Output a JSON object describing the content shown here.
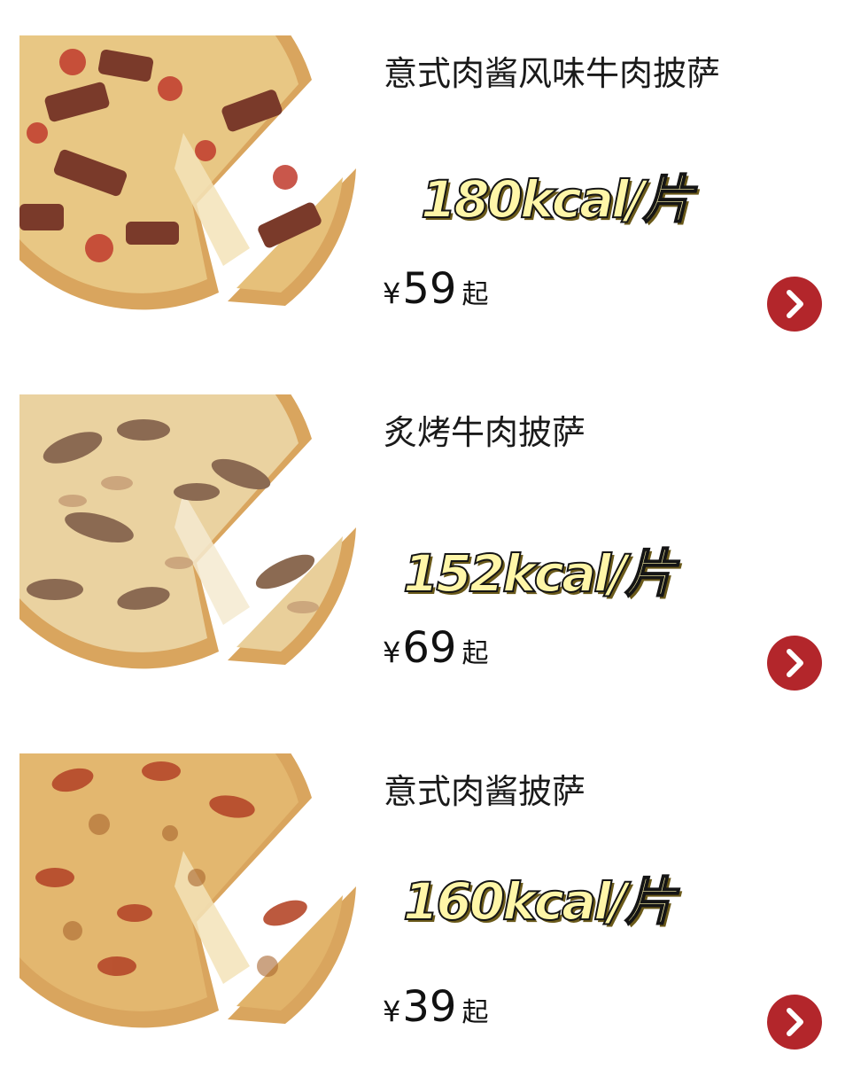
{
  "products": [
    {
      "title": "意式肉酱风味牛肉披萨",
      "calories": "180kcal/片",
      "currency": "¥",
      "price": "59",
      "price_suffix": "起",
      "topping_color": "#7a3a2a"
    },
    {
      "title": "炙烤牛肉披萨",
      "calories": "152kcal/片",
      "currency": "¥",
      "price": "69",
      "price_suffix": "起",
      "topping_color": "#8b6a52"
    },
    {
      "title": "意式肉酱披萨",
      "calories": "160kcal/片",
      "currency": "¥",
      "price": "39",
      "price_suffix": "起",
      "topping_color": "#b5482a"
    }
  ],
  "colors": {
    "accent_button": "#b3262b",
    "calorie_fill": "#fff6a8"
  },
  "icons": {
    "detail_button": "chevron-right-icon",
    "product_image": "pizza-image"
  }
}
